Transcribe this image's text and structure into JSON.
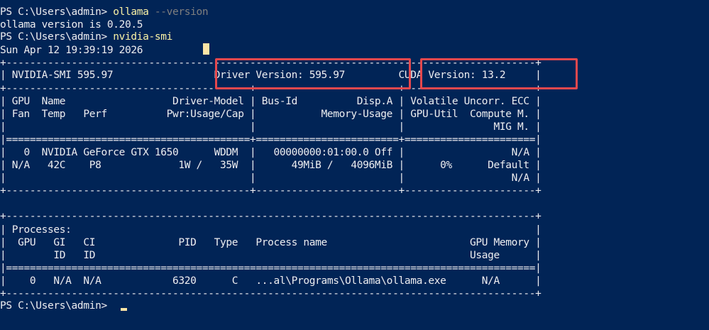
{
  "terminal": {
    "prompt": "PS C:\\Users\\admin> ",
    "cmd1": "ollama",
    "cmd1_param": " --version",
    "out1": "ollama version is 0.20.5",
    "cmd2": "nvidia-smi",
    "date": "Sun Apr 12 19:39:19 2026",
    "prompt_final": "PS C:\\Users\\admin> "
  },
  "smi": {
    "border_top": "+-----------------------------------------------------------------------------------------+",
    "header": "| NVIDIA-SMI 595.97                 Driver Version: 595.97         CUDA Version: 13.2     |",
    "sep1": "+-----------------------------------------+------------------------+----------------------+",
    "col1": "| GPU  Name                  Driver-Model | Bus-Id          Disp.A | Volatile Uncorr. ECC |",
    "col2": "| Fan  Temp   Perf          Pwr:Usage/Cap |           Memory-Usage | GPU-Util  Compute M. |",
    "col3": "|                                         |                        |               MIG M. |",
    "sep2": "|=========================================+========================+======================|",
    "gpu1": "|   0  NVIDIA GeForce GTX 1650      WDDM  |   00000000:01:00.0 Off |                  N/A |",
    "gpu2": "| N/A   42C    P8             1W /   35W  |      49MiB /   4096MiB |      0%      Default |",
    "gpu3": "|                                         |                        |                  N/A |",
    "sep3": "+-----------------------------------------+------------------------+----------------------+",
    "blank": "",
    "p_top": "+-----------------------------------------------------------------------------------------+",
    "p_title": "| Processes:                                                                              |",
    "p_col1": "|  GPU   GI   CI              PID   Type   Process name                        GPU Memory |",
    "p_col2": "|        ID   ID                                                               Usage      |",
    "p_sep": "|=========================================================================================|",
    "p_row1": "|    0   N/A  N/A            6320      C   ...al\\Programs\\Ollama\\ollama.exe      N/A      |",
    "p_bottom": "+-----------------------------------------------------------------------------------------+"
  },
  "highlight_color": "#e5484d",
  "background_color": "#012456"
}
